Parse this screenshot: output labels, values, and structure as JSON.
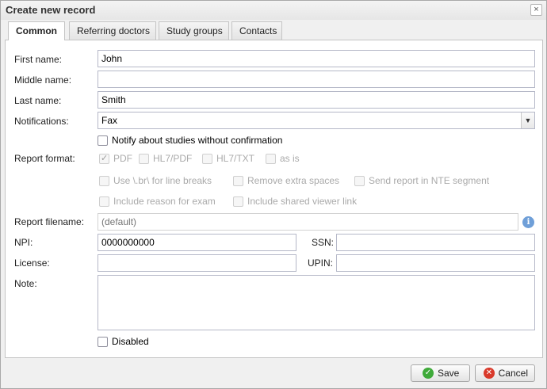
{
  "dialog": {
    "title": "Create new record",
    "close_glyph": "×"
  },
  "tabs": [
    {
      "label": "Common",
      "active": true
    },
    {
      "label": "Referring doctors",
      "active": false
    },
    {
      "label": "Study groups",
      "active": false
    },
    {
      "label": "Contacts",
      "active": false
    }
  ],
  "form": {
    "first_name": {
      "label": "First name:",
      "value": "John"
    },
    "middle_name": {
      "label": "Middle name:",
      "value": ""
    },
    "last_name": {
      "label": "Last name:",
      "value": "Smith"
    },
    "notifications": {
      "label": "Notifications:",
      "value": "Fax"
    },
    "notify_without_confirmation": {
      "label": "Notify about studies without confirmation",
      "checked": false
    },
    "report_format": {
      "label": "Report format:",
      "options": [
        {
          "label": "PDF",
          "checked": true
        },
        {
          "label": "HL7/PDF",
          "checked": false
        },
        {
          "label": "HL7/TXT",
          "checked": false
        },
        {
          "label": "as is",
          "checked": false
        }
      ]
    },
    "report_options": [
      {
        "label": "Use \\.br\\ for line breaks",
        "checked": false
      },
      {
        "label": "Remove extra spaces",
        "checked": false
      },
      {
        "label": "Send report in NTE segment",
        "checked": false
      },
      {
        "label": "Include reason for exam",
        "checked": false
      },
      {
        "label": "Include shared viewer link",
        "checked": false
      }
    ],
    "report_filename": {
      "label": "Report filename:",
      "placeholder": "(default)"
    },
    "npi": {
      "label": "NPI:",
      "value": "0000000000"
    },
    "ssn": {
      "label": "SSN:",
      "value": ""
    },
    "license": {
      "label": "License:",
      "value": ""
    },
    "upin": {
      "label": "UPIN:",
      "value": ""
    },
    "note": {
      "label": "Note:",
      "value": ""
    },
    "disabled": {
      "label": "Disabled",
      "checked": false
    }
  },
  "footer": {
    "save_label": "Save",
    "cancel_label": "Cancel"
  },
  "icons": {
    "info": "info-icon",
    "save": "check-circle-icon",
    "cancel": "cancel-circle-icon",
    "dropdown": "chevron-down-icon"
  }
}
